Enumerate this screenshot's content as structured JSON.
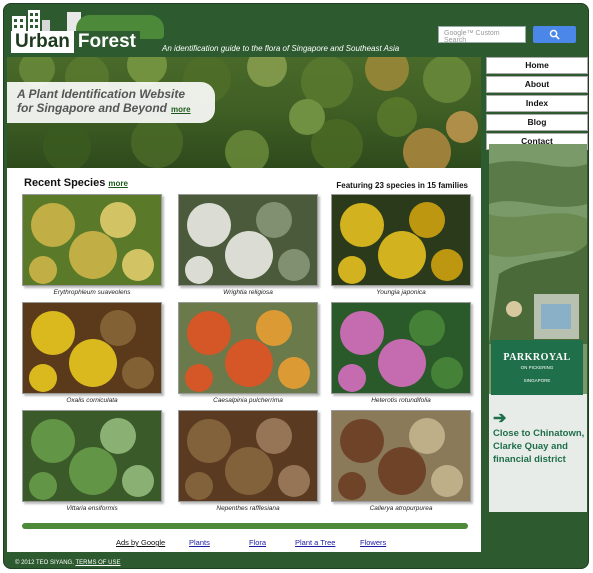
{
  "header": {
    "logo_urban": "Urban",
    "logo_forest": "Forest",
    "tagline": "An identification guide to the flora of Singapore and Southeast Asia",
    "search_placeholder": "Google™ Custom Search",
    "search_icon": "search-icon"
  },
  "hero": {
    "title_line1": "A Plant Identification Website",
    "title_line2": "for Singapore and Beyond",
    "more_label": "more"
  },
  "recent": {
    "heading": "Recent Species",
    "more_label": "more",
    "featuring": "Featuring 23 species in 15 families",
    "species": [
      {
        "name": "Erythrophleum suaveolens",
        "colors": [
          "#5a7a2a",
          "#d4b84a",
          "#e8d070"
        ]
      },
      {
        "name": "Wrightia religiosa",
        "colors": [
          "#4a5a3a",
          "#f4f4f0",
          "#8a9a7a"
        ]
      },
      {
        "name": "Youngia japonica",
        "colors": [
          "#2a3a1a",
          "#f0c820",
          "#d8a810"
        ]
      },
      {
        "name": "Oxalis corniculata",
        "colors": [
          "#5a3a1a",
          "#f0d020",
          "#8a6a3a"
        ]
      },
      {
        "name": "Caesalpinia pulcherrima",
        "colors": [
          "#6a7a4a",
          "#e85020",
          "#f0a030"
        ]
      },
      {
        "name": "Heterotis rotundifolia",
        "colors": [
          "#2a5a2a",
          "#e070c8",
          "#4a8a3a"
        ]
      },
      {
        "name": "Vittaria ensiformis",
        "colors": [
          "#3a5a2a",
          "#6aa04a",
          "#9ac080"
        ]
      },
      {
        "name": "Nepenthes rafflesiana",
        "colors": [
          "#5a3a20",
          "#8a6a40",
          "#a08060"
        ]
      },
      {
        "name": "Callerya atropurpurea",
        "colors": [
          "#8a7a5a",
          "#6a3a20",
          "#c8b890"
        ]
      }
    ]
  },
  "footer": {
    "ads_label": "Ads by Google",
    "links": [
      "Plants",
      "Flora",
      "Plant a Tree",
      "Flowers"
    ],
    "copyright": "© 2012 TEO SIYANG.",
    "terms": "TERMS OF USE"
  },
  "nav": {
    "items": [
      "Home",
      "About",
      "Index",
      "Blog",
      "Contact"
    ]
  },
  "ad": {
    "brand": "PARKROYAL",
    "brand_sub": "ON PICKERING",
    "brand_city": "SINGAPORE",
    "text": "Close to Chinatown, Clarke Quay and financial district",
    "arrow_icon": "arrow-right-icon"
  },
  "colors": {
    "frame_green": "#2d5a2f",
    "accent_green": "#4c8a3a",
    "link_blue": "#1a1aa6",
    "search_blue": "#4a87e8",
    "ad_green": "#1f6f4a"
  }
}
